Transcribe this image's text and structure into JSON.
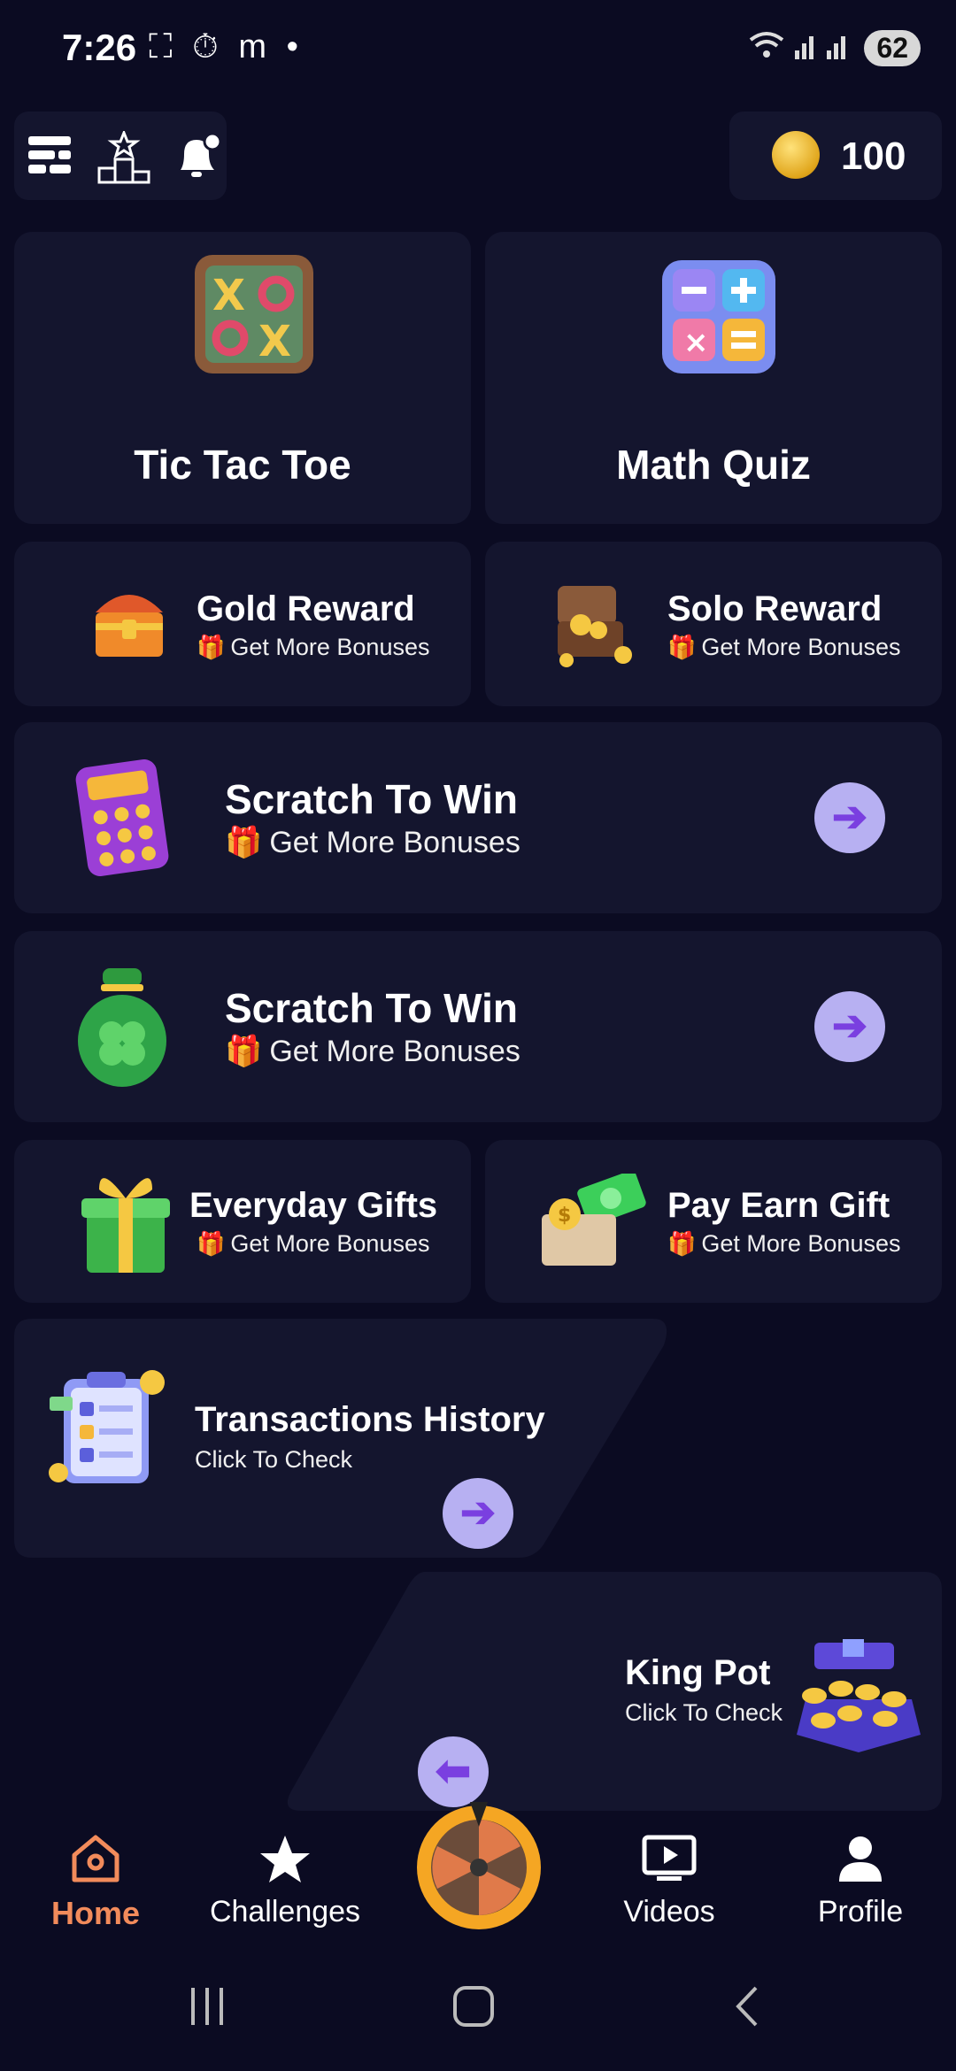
{
  "status_bar": {
    "time": "7:26",
    "left_icons": "⛶ ⏱ m •",
    "signal": "📶 📶",
    "battery": "62"
  },
  "top_bar": {
    "menu_icon": "grid-menu-icon",
    "leaderboard_icon": "podium-icon",
    "notification_icon": "bell-icon",
    "coin_balance": "100"
  },
  "games": [
    {
      "title": "Tic Tac Toe",
      "icon": "tic-tac-toe-icon"
    },
    {
      "title": "Math Quiz",
      "icon": "math-quiz-icon"
    }
  ],
  "rewards_row1": [
    {
      "title": "Gold Reward",
      "subtitle": "Get More Bonuses",
      "icon": "treasure-chest-icon"
    },
    {
      "title": "Solo Reward",
      "subtitle": "Get More Bonuses",
      "icon": "open-chest-icon"
    }
  ],
  "scratch_cards": [
    {
      "title": "Scratch To Win",
      "subtitle": "Get More Bonuses",
      "icon": "scratch-card-icon"
    },
    {
      "title": "Scratch To Win",
      "subtitle": "Get More Bonuses",
      "icon": "clover-bag-icon"
    }
  ],
  "rewards_row2": [
    {
      "title": "Everyday Gifts",
      "subtitle": "Get More Bonuses",
      "icon": "gift-box-icon"
    },
    {
      "title": "Pay Earn Gift",
      "subtitle": "Get More Bonuses",
      "icon": "money-box-icon"
    }
  ],
  "transactions": {
    "title": "Transactions History",
    "subtitle": "Click To Check"
  },
  "king_pot": {
    "title": "King Pot",
    "subtitle": "Click To Check"
  },
  "bottom_nav": [
    {
      "label": "Home",
      "icon": "home-icon"
    },
    {
      "label": "Challenges",
      "icon": "star-icon"
    },
    {
      "label": "",
      "icon": "spin-wheel-icon"
    },
    {
      "label": "Videos",
      "icon": "video-icon"
    },
    {
      "label": "Profile",
      "icon": "profile-icon"
    }
  ],
  "colors": {
    "background": "#0b0b22",
    "card": "#14152e",
    "accent": "#f28b5b",
    "arrow_bg": "#b7b0f2"
  }
}
